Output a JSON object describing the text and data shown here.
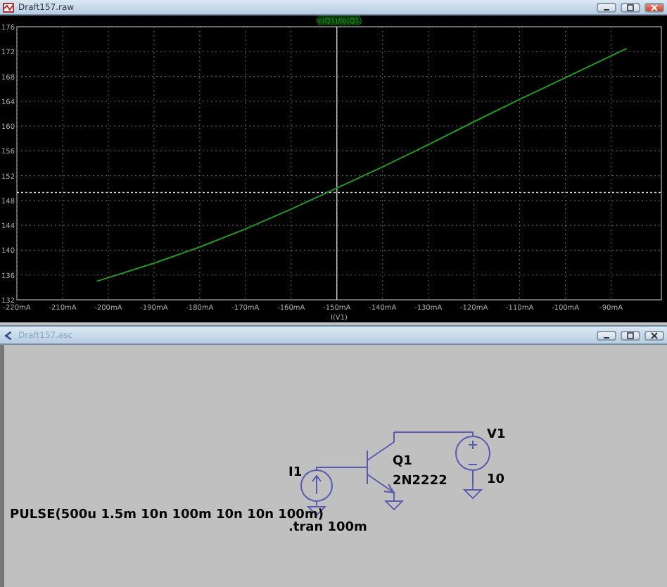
{
  "waveform_window": {
    "title": "Draft157.raw",
    "chart_data": {
      "type": "line",
      "xlabel": "I(V1)",
      "x": [
        -202.5,
        -190,
        -180,
        -170,
        -160,
        -150,
        -140,
        -130,
        -120,
        -110,
        -100,
        -86.6
      ],
      "series": [
        {
          "name": "Ic(Q1)/Ib(Q1)",
          "color": "#1f9a1f",
          "values": [
            135,
            137.9,
            140.5,
            143.4,
            146.6,
            150,
            153.4,
            157,
            160.7,
            164.3,
            167.8,
            172.5
          ]
        }
      ],
      "xlim": [
        -220,
        -79
      ],
      "ylim": [
        132,
        176
      ],
      "xticks": [
        {
          "value": -220,
          "label": "-220mA"
        },
        {
          "value": -210,
          "label": "-210mA"
        },
        {
          "value": -200,
          "label": "-200mA"
        },
        {
          "value": -190,
          "label": "-190mA"
        },
        {
          "value": -180,
          "label": "-180mA"
        },
        {
          "value": -170,
          "label": "-170mA"
        },
        {
          "value": -160,
          "label": "-160mA"
        },
        {
          "value": -150,
          "label": "-150mA"
        },
        {
          "value": -140,
          "label": "-140mA"
        },
        {
          "value": -130,
          "label": "-130mA"
        },
        {
          "value": -120,
          "label": "-120mA"
        },
        {
          "value": -110,
          "label": "-110mA"
        },
        {
          "value": -100,
          "label": "-100mA"
        },
        {
          "value": -90,
          "label": "-90mA"
        }
      ],
      "yticks": [
        132,
        136,
        140,
        144,
        148,
        152,
        156,
        160,
        164,
        168,
        172,
        176
      ],
      "grid": true,
      "ref_lines": [
        {
          "axis": "x",
          "value": -150
        },
        {
          "axis": "y",
          "value": 149.3
        }
      ]
    }
  },
  "schematic_window": {
    "title": "Draft157.asc",
    "components": [
      {
        "kind": "current_source",
        "name": "I1",
        "value": "PULSE(500u 1.5m 10n 100m 10n 10n 100m)"
      },
      {
        "kind": "npn",
        "name": "Q1",
        "value": "2N2222"
      },
      {
        "kind": "voltage_source",
        "name": "V1",
        "value": "10"
      }
    ],
    "directives": [
      ".tran 100m"
    ]
  }
}
